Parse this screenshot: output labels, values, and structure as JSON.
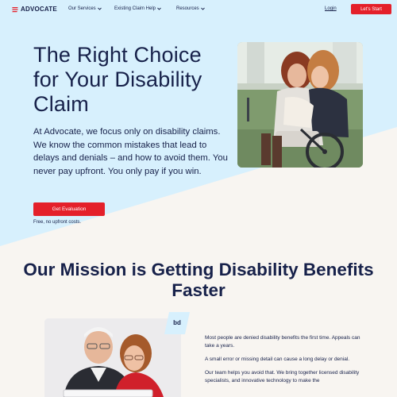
{
  "nav": {
    "logo_text": "ADVOCATE",
    "menu": [
      {
        "label": "Our Services"
      },
      {
        "label": "Existing Claim Help"
      },
      {
        "label": "Resources"
      }
    ],
    "login_label": "Login",
    "start_label": "Let's Start"
  },
  "hero": {
    "title": "The Right Choice for Your Disability Claim",
    "description": "At Advocate, we focus only on disability claims. We know the common mistakes that lead to delays and denials – and how to avoid them. You never pay upfront. You only pay if you win.",
    "cta_label": "Get Evaluation",
    "cta_note": "Free, no upfront costs."
  },
  "mission": {
    "title": "Our Mission is Getting Disability Benefits Faster",
    "badge": "bd",
    "paragraphs": [
      "Most people are denied disability benefits the first time. Appeals can take a years.",
      "A small error or missing detail can cause a long delay or denial.",
      "Our team helps you avoid that. We bring together licensed disability specialists, and innovative technology to make the"
    ]
  },
  "colors": {
    "brand_navy": "#17214a",
    "accent_red": "#e4202a",
    "hero_blue": "#d7f0fd",
    "page_cream": "#f8f5f1"
  }
}
